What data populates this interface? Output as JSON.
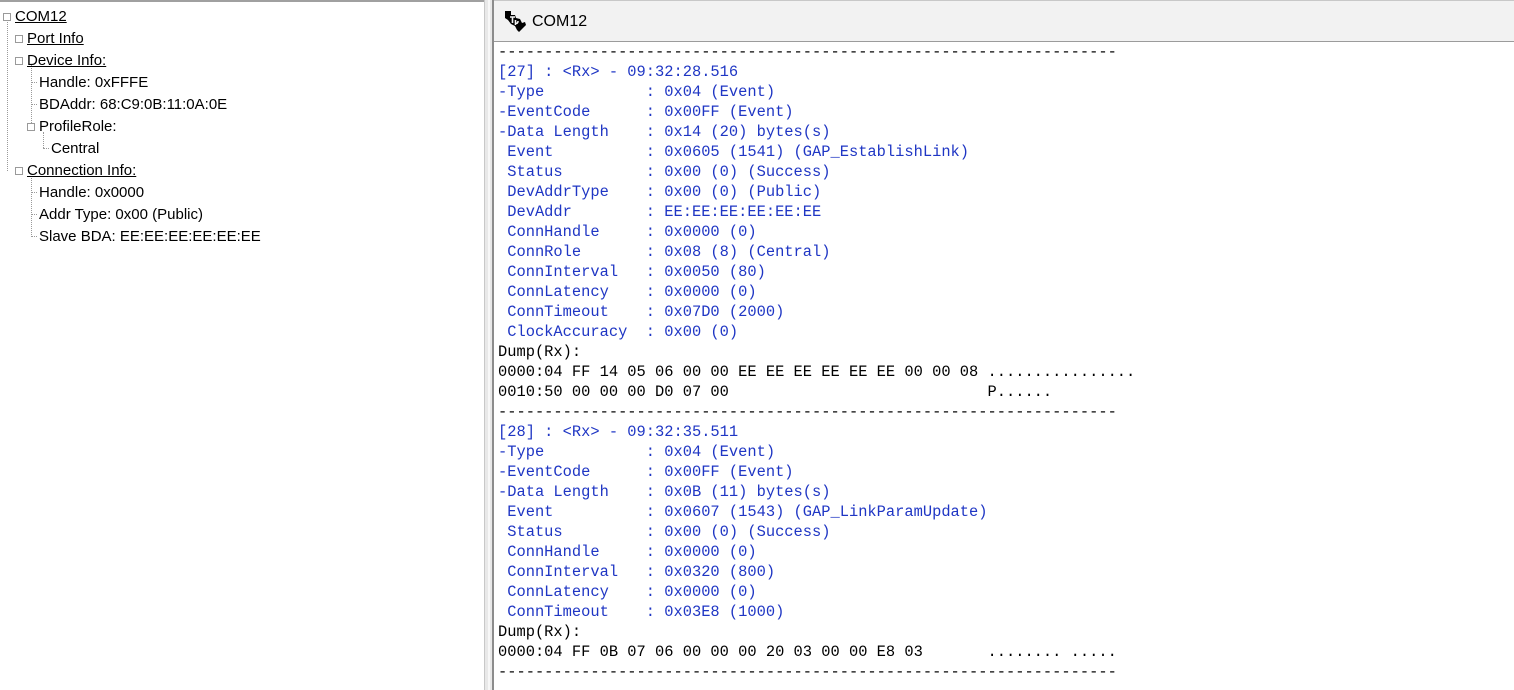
{
  "tree": {
    "root": "COM12",
    "port_info": "Port Info",
    "device_info": "Device Info:",
    "device_handle": "Handle: 0xFFFE",
    "bdaddr": "BDAddr: 68:C9:0B:11:0A:0E",
    "profile_role": "ProfileRole:",
    "profile_role_value": "Central",
    "connection_info": "Connection Info:",
    "conn_handle": "Handle: 0x0000",
    "addr_type": "Addr Type: 0x00 (Public)",
    "slave_bda": "Slave BDA: EE:EE:EE:EE:EE:EE"
  },
  "log": {
    "title": "COM12",
    "icon": "texas-instruments-logo-icon",
    "colors": {
      "field": "#1f36c4",
      "raw": "#000000"
    },
    "lines": [
      {
        "text": "-------------------------------------------------------------------",
        "style": "black"
      },
      {
        "text": "[27] : <Rx> - 09:32:28.516",
        "style": "blue"
      },
      {
        "text": "-Type           : 0x04 (Event)",
        "style": "blue"
      },
      {
        "text": "-EventCode      : 0x00FF (Event)",
        "style": "blue"
      },
      {
        "text": "-Data Length    : 0x14 (20) bytes(s)",
        "style": "blue"
      },
      {
        "text": " Event          : 0x0605 (1541) (GAP_EstablishLink)",
        "style": "blue"
      },
      {
        "text": " Status         : 0x00 (0) (Success)",
        "style": "blue"
      },
      {
        "text": " DevAddrType    : 0x00 (0) (Public)",
        "style": "blue"
      },
      {
        "text": " DevAddr        : EE:EE:EE:EE:EE:EE",
        "style": "blue"
      },
      {
        "text": " ConnHandle     : 0x0000 (0)",
        "style": "blue"
      },
      {
        "text": " ConnRole       : 0x08 (8) (Central)",
        "style": "blue"
      },
      {
        "text": " ConnInterval   : 0x0050 (80)",
        "style": "blue"
      },
      {
        "text": " ConnLatency    : 0x0000 (0)",
        "style": "blue"
      },
      {
        "text": " ConnTimeout    : 0x07D0 (2000)",
        "style": "blue"
      },
      {
        "text": " ClockAccuracy  : 0x00 (0)",
        "style": "blue"
      },
      {
        "text": "Dump(Rx):",
        "style": "black"
      },
      {
        "text": "0000:04 FF 14 05 06 00 00 EE EE EE EE EE EE 00 00 08 ................",
        "style": "black"
      },
      {
        "text": "0010:50 00 00 00 D0 07 00                            P......",
        "style": "black"
      },
      {
        "text": "-------------------------------------------------------------------",
        "style": "black"
      },
      {
        "text": "[28] : <Rx> - 09:32:35.511",
        "style": "blue"
      },
      {
        "text": "-Type           : 0x04 (Event)",
        "style": "blue"
      },
      {
        "text": "-EventCode      : 0x00FF (Event)",
        "style": "blue"
      },
      {
        "text": "-Data Length    : 0x0B (11) bytes(s)",
        "style": "blue"
      },
      {
        "text": " Event          : 0x0607 (1543) (GAP_LinkParamUpdate)",
        "style": "blue"
      },
      {
        "text": " Status         : 0x00 (0) (Success)",
        "style": "blue"
      },
      {
        "text": " ConnHandle     : 0x0000 (0)",
        "style": "blue"
      },
      {
        "text": " ConnInterval   : 0x0320 (800)",
        "style": "blue"
      },
      {
        "text": " ConnLatency    : 0x0000 (0)",
        "style": "blue"
      },
      {
        "text": " ConnTimeout    : 0x03E8 (1000)",
        "style": "blue"
      },
      {
        "text": "Dump(Rx):",
        "style": "black"
      },
      {
        "text": "0000:04 FF 0B 07 06 00 00 00 20 03 00 00 E8 03       ........ .....",
        "style": "black"
      },
      {
        "text": "-------------------------------------------------------------------",
        "style": "black"
      }
    ]
  }
}
